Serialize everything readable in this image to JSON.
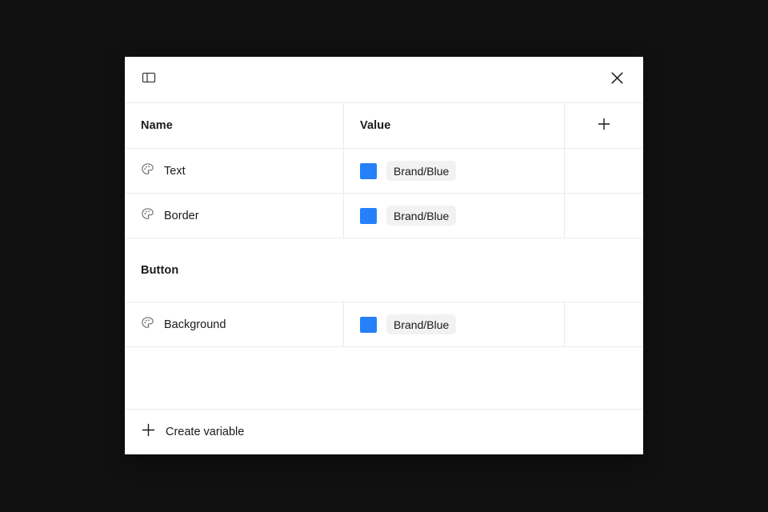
{
  "theme": {
    "page_background": "#111111",
    "dialog_background": "#ffffff",
    "border": "#eaeaea",
    "text": "#1a1a1a",
    "chip_background": "#f2f2f2",
    "accent_blue": "#2680fa"
  },
  "toolbar": {
    "sidebar_toggle_icon": "sidebar-panel-icon",
    "close_icon": "close-icon"
  },
  "table": {
    "columns": [
      {
        "label": "Name"
      },
      {
        "label": "Value"
      },
      {
        "label": "",
        "icon": "plus-icon"
      }
    ],
    "rows": [
      {
        "type": "variable",
        "icon": "color-palette-icon",
        "name": "Text",
        "swatch_color": "#2680fa",
        "value": "Brand/Blue"
      },
      {
        "type": "variable",
        "icon": "color-palette-icon",
        "name": "Border",
        "swatch_color": "#2680fa",
        "value": "Brand/Blue"
      },
      {
        "type": "group",
        "name": "Button"
      },
      {
        "type": "variable",
        "icon": "color-palette-icon",
        "name": "Background",
        "swatch_color": "#2680fa",
        "value": "Brand/Blue"
      }
    ]
  },
  "footer": {
    "icon": "plus-icon",
    "label": "Create variable"
  }
}
